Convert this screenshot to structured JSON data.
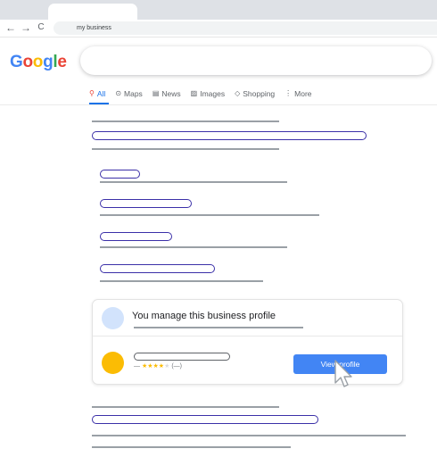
{
  "browser": {
    "address_text": "my business",
    "back_glyph": "←",
    "forward_glyph": "→",
    "reload_glyph": "C"
  },
  "google": {
    "logo_letters": [
      "G",
      "o",
      "o",
      "g",
      "l",
      "e"
    ],
    "logo_colors": [
      "#4285f4",
      "#ea4335",
      "#fbbc04",
      "#4285f4",
      "#34a853",
      "#ea4335"
    ],
    "tabs": [
      {
        "icon": "search-icon",
        "glyph": "⚲",
        "label": "All",
        "active": true
      },
      {
        "icon": "map-pin-icon",
        "glyph": "⊙",
        "label": "Maps",
        "active": false
      },
      {
        "icon": "news-icon",
        "glyph": "▤",
        "label": "News",
        "active": false
      },
      {
        "icon": "images-icon",
        "glyph": "▨",
        "label": "Images",
        "active": false
      },
      {
        "icon": "tag-icon",
        "glyph": "◇",
        "label": "Shopping",
        "active": false
      },
      {
        "icon": "more-icon",
        "glyph": "⋮",
        "label": "More",
        "active": false
      }
    ]
  },
  "profile_card": {
    "title": "You manage this business profile",
    "rating_prefix": "—",
    "stars_filled": 4,
    "stars_total": 5,
    "star_glyph": "★",
    "review_count": "(—)",
    "view_button": "View profile"
  },
  "colors": {
    "accent": "#4285f4",
    "link_pill": "#3b30a8",
    "star": "#fbbc04",
    "business_avatar": "#fbbc04",
    "profile_avatar": "#d2e3fc"
  }
}
